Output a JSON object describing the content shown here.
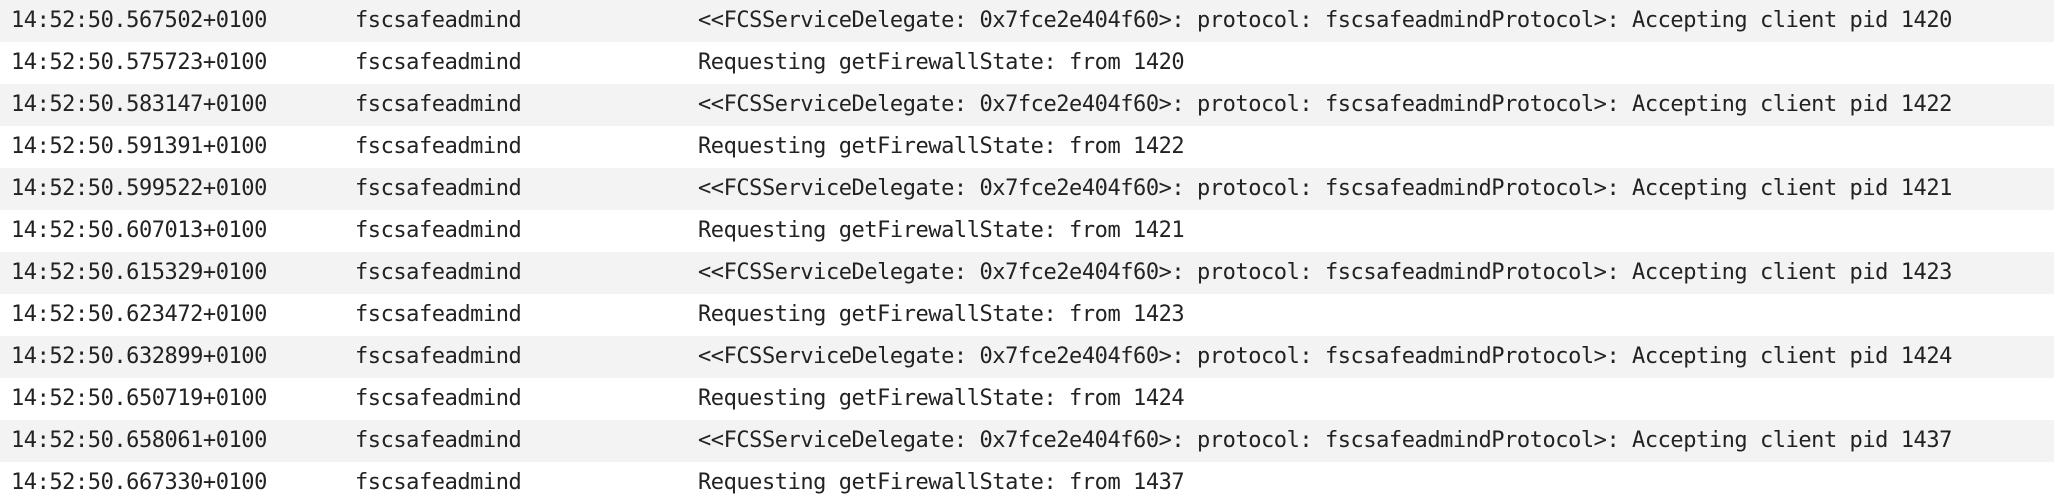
{
  "log": {
    "rows": [
      {
        "time": "14:52:50.567502+0100",
        "process": "fscsafeadmind",
        "message": "<<FCSServiceDelegate: 0x7fce2e404f60>: protocol: fscsafeadmindProtocol>: Accepting client pid 1420"
      },
      {
        "time": "14:52:50.575723+0100",
        "process": "fscsafeadmind",
        "message": "Requesting getFirewallState: from 1420"
      },
      {
        "time": "14:52:50.583147+0100",
        "process": "fscsafeadmind",
        "message": "<<FCSServiceDelegate: 0x7fce2e404f60>: protocol: fscsafeadmindProtocol>: Accepting client pid 1422"
      },
      {
        "time": "14:52:50.591391+0100",
        "process": "fscsafeadmind",
        "message": "Requesting getFirewallState: from 1422"
      },
      {
        "time": "14:52:50.599522+0100",
        "process": "fscsafeadmind",
        "message": "<<FCSServiceDelegate: 0x7fce2e404f60>: protocol: fscsafeadmindProtocol>: Accepting client pid 1421"
      },
      {
        "time": "14:52:50.607013+0100",
        "process": "fscsafeadmind",
        "message": "Requesting getFirewallState: from 1421"
      },
      {
        "time": "14:52:50.615329+0100",
        "process": "fscsafeadmind",
        "message": "<<FCSServiceDelegate: 0x7fce2e404f60>: protocol: fscsafeadmindProtocol>: Accepting client pid 1423"
      },
      {
        "time": "14:52:50.623472+0100",
        "process": "fscsafeadmind",
        "message": "Requesting getFirewallState: from 1423"
      },
      {
        "time": "14:52:50.632899+0100",
        "process": "fscsafeadmind",
        "message": "<<FCSServiceDelegate: 0x7fce2e404f60>: protocol: fscsafeadmindProtocol>: Accepting client pid 1424"
      },
      {
        "time": "14:52:50.650719+0100",
        "process": "fscsafeadmind",
        "message": "Requesting getFirewallState: from 1424"
      },
      {
        "time": "14:52:50.658061+0100",
        "process": "fscsafeadmind",
        "message": "<<FCSServiceDelegate: 0x7fce2e404f60>: protocol: fscsafeadmindProtocol>: Accepting client pid 1437"
      },
      {
        "time": "14:52:50.667330+0100",
        "process": "fscsafeadmind",
        "message": "Requesting getFirewallState: from 1437"
      }
    ]
  }
}
